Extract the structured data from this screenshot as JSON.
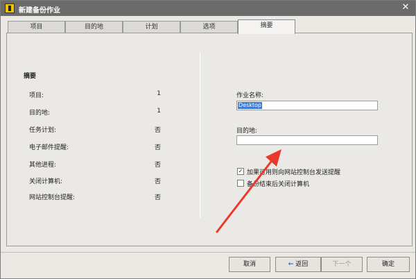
{
  "window": {
    "title": "新建备份作业",
    "close_glyph": "✕"
  },
  "tabs": [
    {
      "label": "项目"
    },
    {
      "label": "目的地"
    },
    {
      "label": "计划"
    },
    {
      "label": "选项"
    },
    {
      "label": "摘要"
    }
  ],
  "summary": {
    "title": "摘要",
    "rows": [
      {
        "key": "项目:",
        "value": "1"
      },
      {
        "key": "目的地:",
        "value": "1"
      },
      {
        "key": "任务计划:",
        "value": "否"
      },
      {
        "key": "电子邮件提醒:",
        "value": "否"
      },
      {
        "key": "其他进程:",
        "value": "否"
      },
      {
        "key": "关闭计算机:",
        "value": "否"
      },
      {
        "key": "网站控制台提醒:",
        "value": "否"
      }
    ]
  },
  "form": {
    "job_name_label": "作业名称:",
    "job_name_value": "Desktop",
    "destination_label": "目的地:",
    "destination_value": "",
    "checkbox1_label": "加果可用则向网站控制台发送提醒",
    "checkbox1_checked": "✓",
    "checkbox2_label": "备份结束后关闭计算机",
    "checkbox2_checked": ""
  },
  "buttons": {
    "cancel": "取消",
    "back": "返回",
    "back_arrow": "←",
    "next": "下一个",
    "ok": "确定"
  },
  "colors": {
    "titlebar": "#6b6b6b",
    "selection": "#3a7bd5",
    "arrow": "#e8392b"
  }
}
